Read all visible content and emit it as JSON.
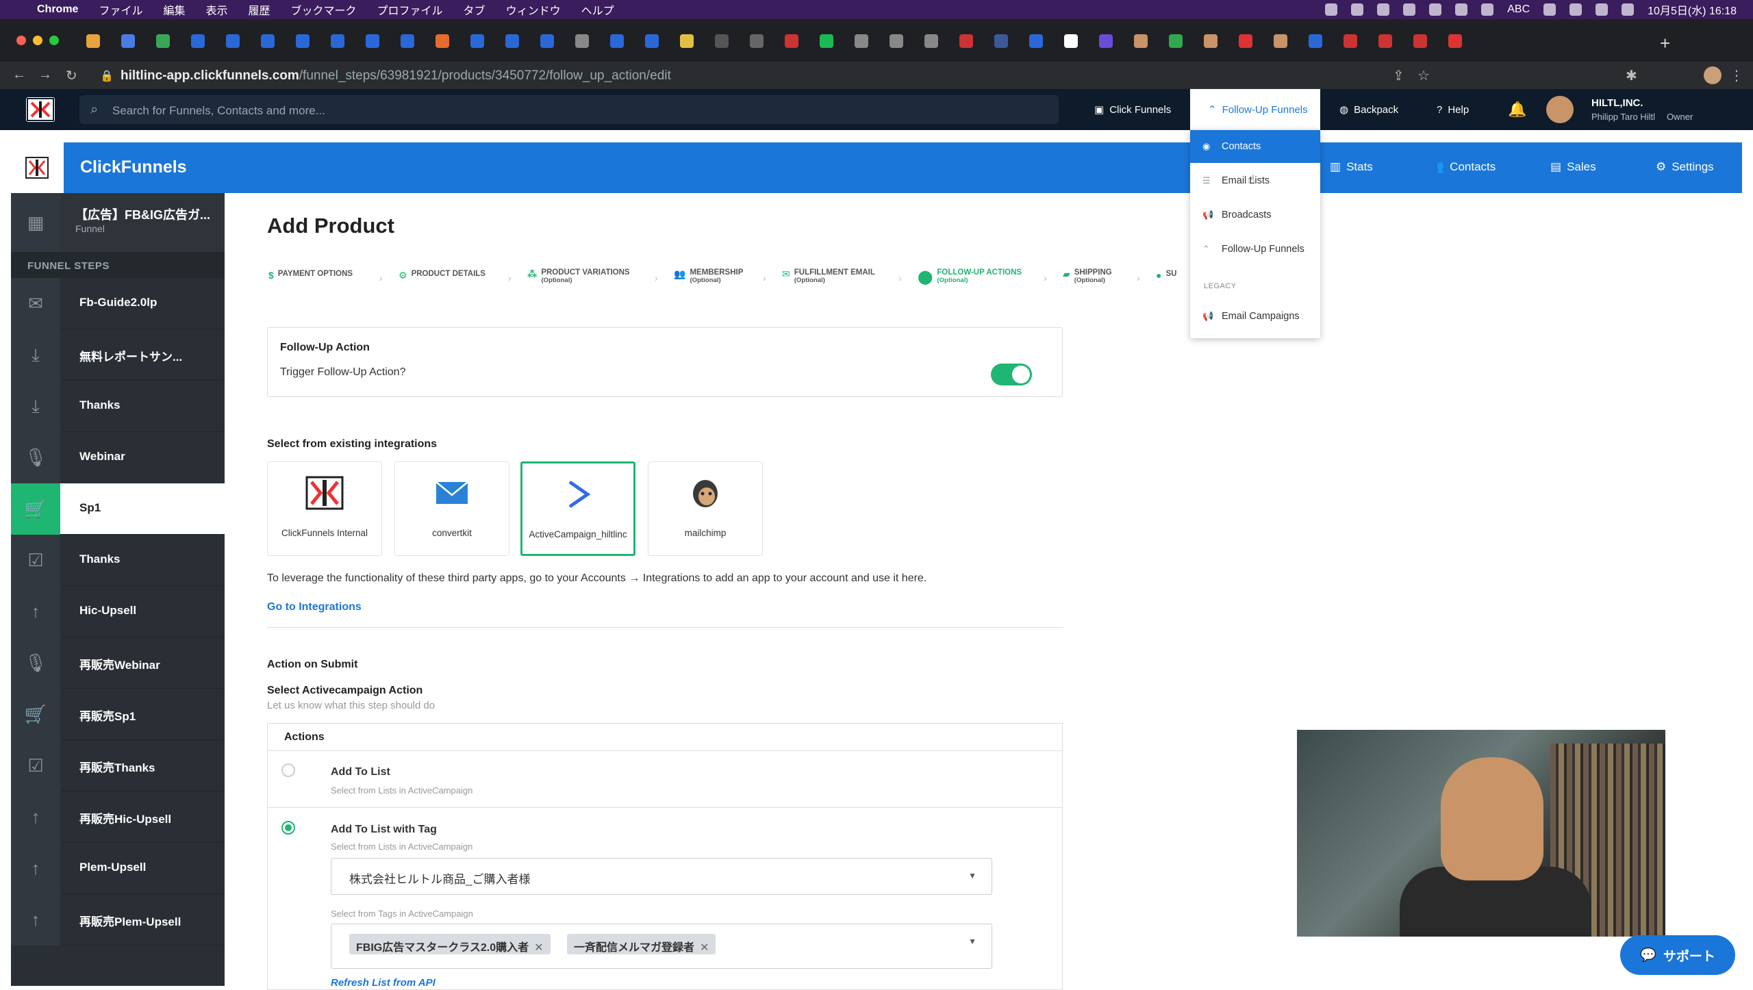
{
  "menubar": {
    "app": "Chrome",
    "menus": [
      "ファイル",
      "編集",
      "表示",
      "履歴",
      "ブックマーク",
      "プロファイル",
      "タブ",
      "ウィンドウ",
      "ヘルプ"
    ],
    "abc": "ABC",
    "clock": "10月5日(水) 16:18"
  },
  "browser": {
    "url_host": "hiltlinc-app.clickfunnels.com",
    "url_path": "/funnel_steps/63981921/products/3450772/follow_up_action/edit"
  },
  "topnav": {
    "search_placeholder": "Search for Funnels, Contacts and more...",
    "clickfunnels": "Click Funnels",
    "followup": "Follow-Up Funnels",
    "backpack": "Backpack",
    "help": "Help",
    "account_name": "HILTL,INC.",
    "account_user": "Philipp Taro Hiltl",
    "account_role": "Owner"
  },
  "header": {
    "brand": "ClickFunnels",
    "stats": "Stats",
    "contacts": "Contacts",
    "sales": "Sales",
    "settings": "Settings"
  },
  "dropdown": {
    "items": [
      "Contacts",
      "Email Lists",
      "Broadcasts",
      "Follow-Up Funnels"
    ],
    "legacy_label": "LEGACY",
    "legacy_item": "Email Campaigns"
  },
  "sidebar": {
    "funnel_title": "【広告】FB&IG広告ガ...",
    "funnel_sub": "Funnel",
    "section": "FUNNEL STEPS",
    "steps": [
      "Fb-Guide2.0lp",
      "無料レポートサン...",
      "Thanks",
      "Webinar",
      "Sp1",
      "Thanks",
      "Hic-Upsell",
      "再販売Webinar",
      "再販売Sp1",
      "再販売Thanks",
      "再販売Hic-Upsell",
      "Plem-Upsell",
      "再販売Plem-Upsell"
    ]
  },
  "page": {
    "title": "Add Product",
    "wizard": [
      {
        "label": "PAYMENT OPTIONS",
        "sub": ""
      },
      {
        "label": "PRODUCT DETAILS",
        "sub": ""
      },
      {
        "label": "PRODUCT VARIATIONS",
        "sub": "(Optional)"
      },
      {
        "label": "MEMBERSHIP",
        "sub": "(Optional)"
      },
      {
        "label": "FULFILLMENT EMAIL",
        "sub": "(Optional)"
      },
      {
        "label": "FOLLOW-UP ACTIONS",
        "sub": "(Optional)"
      },
      {
        "label": "SHIPPING",
        "sub": "(Optional)"
      },
      {
        "label": "SU",
        "sub": ""
      }
    ],
    "followup_title": "Follow-Up Action",
    "followup_question": "Trigger Follow-Up Action?",
    "integrations_heading": "Select from existing integrations",
    "integrations": [
      "ClickFunnels Internal",
      "convertkit",
      "ActiveCampaign_hiltlinc",
      "mailchimp"
    ],
    "integrations_note": "To leverage the functionality of these third party apps, go to your Accounts → Integrations to add an app to your account and use it here.",
    "integrations_link": "Go to Integrations",
    "action_on_submit": "Action on Submit",
    "select_action": "Select Activecampaign Action",
    "select_action_sub": "Let us know what this step should do",
    "actions_header": "Actions",
    "opt1": "Add To List",
    "opt1_sub": "Select from Lists in ActiveCampaign",
    "opt2": "Add To List with Tag",
    "opt2_sub": "Select from Lists in ActiveCampaign",
    "list_value": "株式会社ヒルトル商品_ご購入者様",
    "tags_sub": "Select from Tags in ActiveCampaign",
    "tags": [
      "FBIG広告マスタークラス2.0購入者",
      "一斉配信メルマガ登録者"
    ],
    "refresh": "Refresh List from API"
  },
  "support": "サポート",
  "colors": {
    "accent": "#1a76d9",
    "success": "#1fb572",
    "nav": "#0d1b2a",
    "sidebar": "#2a2f35"
  }
}
